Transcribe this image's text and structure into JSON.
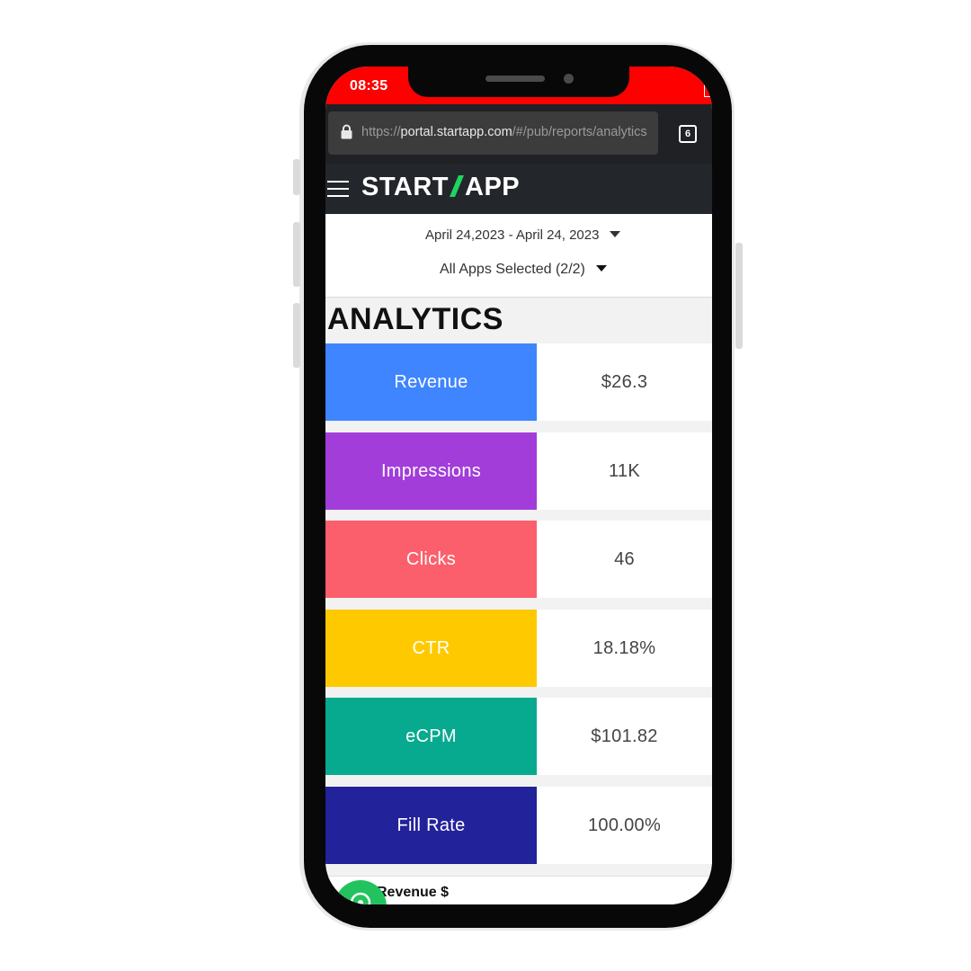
{
  "status_bar": {
    "time": "08:35"
  },
  "browser": {
    "url_prefix": "https://",
    "url_host": "portal.startapp.com",
    "url_path": "/#/pub/reports/analytics",
    "tab_count": "6"
  },
  "app": {
    "logo_left": "START",
    "logo_right": "APP"
  },
  "filters": {
    "date_range": "April 24,2023 - April 24, 2023",
    "apps_selected": "All Apps Selected (2/2)"
  },
  "section_title": "ANALYTICS",
  "metrics": [
    {
      "label": "Revenue",
      "value": "$26.3",
      "color": "#3f85ff"
    },
    {
      "label": "Impressions",
      "value": "11K",
      "color": "#a23dda"
    },
    {
      "label": "Clicks",
      "value": "46",
      "color": "#fc5f6c"
    },
    {
      "label": "CTR",
      "value": "18.18%",
      "color": "#ffc900"
    },
    {
      "label": "eCPM",
      "value": "$101.82",
      "color": "#08aa8f"
    },
    {
      "label": "Fill Rate",
      "value": "100.00%",
      "color": "#22229a"
    }
  ],
  "bottom_card": {
    "label": "Revenue $"
  },
  "colors": {
    "status_bar": "#ff0000",
    "app_bar": "#23272b",
    "url_bar": "#202124",
    "logo_accent": "#1fd561",
    "fab": "#22c35e"
  },
  "icons": {
    "lock": "lock-icon",
    "tabs": "tab-switcher-icon",
    "menu": "hamburger-menu-icon",
    "caret": "caret-down-icon",
    "chat": "chat-icon"
  }
}
